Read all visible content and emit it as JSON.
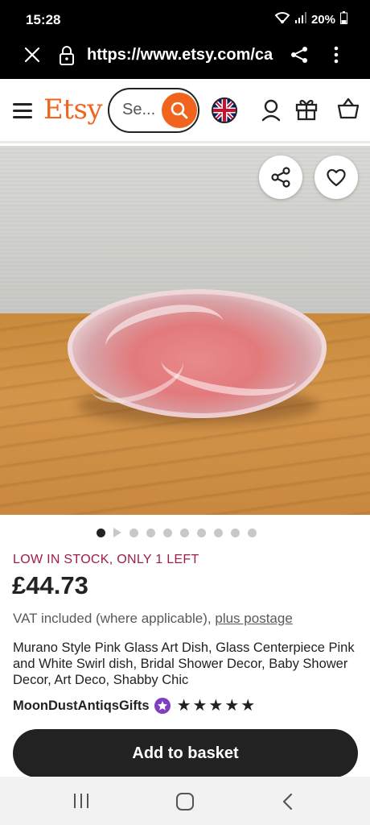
{
  "status_bar": {
    "time": "15:28",
    "battery": "20%",
    "icons": [
      "wifi-icon",
      "signal-icon",
      "battery-icon"
    ]
  },
  "browser": {
    "url": "https://www.etsy.com/ca",
    "icons": [
      "close-icon",
      "lock-icon",
      "share-icon",
      "more-vert-icon"
    ]
  },
  "header": {
    "logo": "Etsy",
    "search_placeholder": "Se...",
    "icons": [
      "menu-icon",
      "search-icon",
      "uk-flag-icon",
      "account-icon",
      "gift-icon",
      "basket-icon"
    ]
  },
  "gallery": {
    "total_images": 10,
    "active_index": 0,
    "has_video": true,
    "icons": [
      "share-icon",
      "heart-icon"
    ]
  },
  "product": {
    "stock_notice": "LOW IN STOCK, ONLY 1 LEFT",
    "price": "£44.73",
    "vat_text": "VAT included (where applicable),",
    "postage_link": "plus postage",
    "title": "Murano Style Pink Glass Art Dish, Glass Centerpiece Pink and White Swirl dish, Bridal Shower Decor, Baby Shower Decor, Art Deco, Shabby Chic",
    "shop_name": "MoonDustAntiqsGifts",
    "rating": 5,
    "stars": "★★★★★",
    "add_to_basket_label": "Add to basket"
  },
  "colors": {
    "etsy_orange": "#f1641e",
    "stock_red": "#a01c4e",
    "star_seller_purple": "#7f3fbf",
    "button_dark": "#222222"
  },
  "nav_bar": {
    "icons": [
      "recent-apps-icon",
      "home-icon",
      "back-icon"
    ]
  }
}
